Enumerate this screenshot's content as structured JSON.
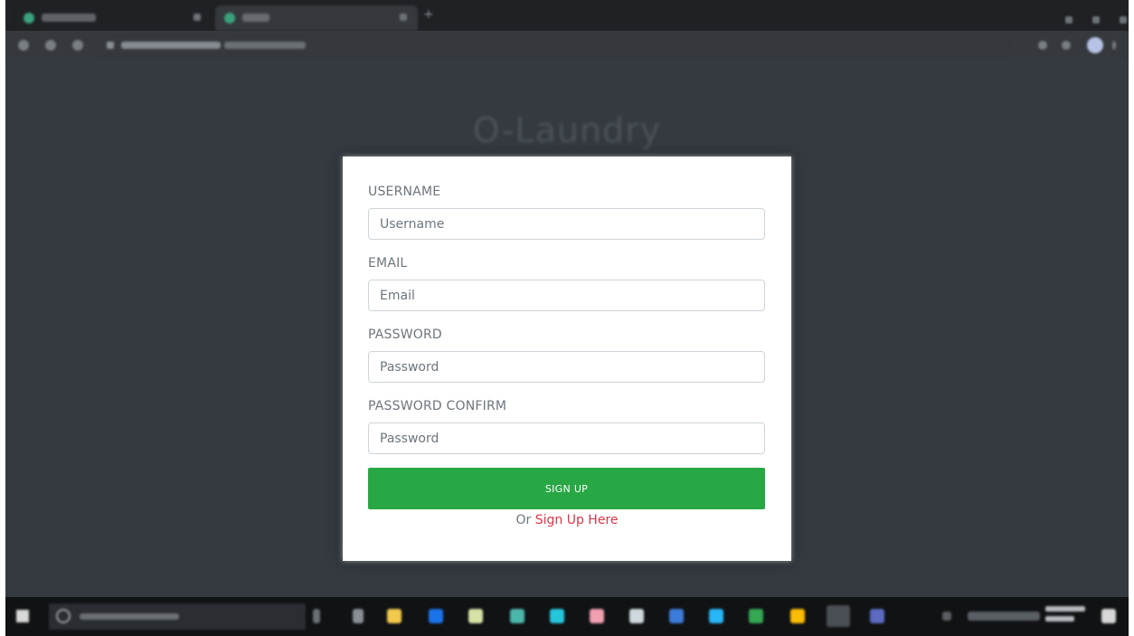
{
  "brand": {
    "title": "O-Laundry"
  },
  "form": {
    "username": {
      "label": "USERNAME",
      "placeholder": "Username"
    },
    "email": {
      "label": "EMAIL",
      "placeholder": "Email"
    },
    "password": {
      "label": "PASSWORD",
      "placeholder": "Password"
    },
    "password_confirm": {
      "label": "PASSWORD CONFIRM",
      "placeholder": "Password"
    },
    "submit_label": "SIGN UP",
    "alt_prefix": "Or",
    "alt_link": "Sign Up Here"
  },
  "colors": {
    "page_background": "#343a40",
    "submit_button": "#28a745",
    "link": "#dc3545"
  },
  "icons": {
    "browser_tab_favicon": "laundry-app-favicon",
    "taskbar_start": "windows-start-icon",
    "taskbar_search": "search-icon"
  }
}
